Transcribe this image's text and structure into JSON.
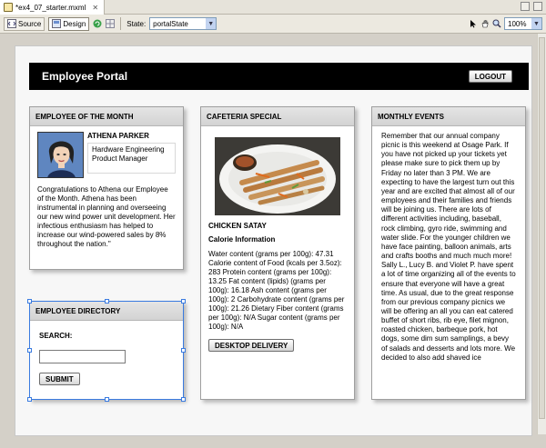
{
  "editor": {
    "tab_label": "*ex4_07_starter.mxml",
    "source_label": "Source",
    "design_label": "Design",
    "state_label": "State:",
    "state_value": "portalState",
    "zoom_value": "100%"
  },
  "header": {
    "title": "Employee Portal",
    "logout_label": "LOGOUT"
  },
  "employee_of_month": {
    "heading": "EMPLOYEE OF THE MONTH",
    "name": "ATHENA PARKER",
    "department": "Hardware Engineering",
    "role": "Product Manager",
    "blurb": "Congratulations to Athena our Employee of the Month. Athena has been instrumental in planning and overseeing our new wind power unit development. Her infectious enthusiasm has helped to increase our wind-powered sales by 8% throughout the nation.\""
  },
  "cafeteria": {
    "heading": "CAFETERIA SPECIAL",
    "dish": "CHICKEN SATAY",
    "info_heading": "Calorie Information",
    "info_text": "Water content (grams per 100g): 47.31 Calorie content of Food (kcals per 3.5oz): 283 Protein content (grams per 100g): 13.25 Fat content (lipids) (grams per 100g): 16.18 Ash content (grams per 100g): 2 Carbohydrate content (grams per 100g): 21.26 Dietary Fiber content (grams per 100g): N/A Sugar content (grams per 100g): N/A",
    "delivery_label": "DESKTOP DELIVERY"
  },
  "events": {
    "heading": "MONTHLY EVENTS",
    "text": "Remember that our annual company picnic is this weekend at Osage Park. If you have not picked up your tickets yet please make sure to pick them up by Friday no later than 3 PM. We are expecting to have the largest turn out this year and are excited that almost all of our employees and their families and friends will be joining us. There are lots of different activities including, baseball, rock climbing, gyro ride, swimming and water slide. For the younger children we have face painting, balloon animals, arts and crafts booths and much much more! Sally L., Lucy B. and Violet P. have spent a lot of time organizing all of the events to ensure that everyone will have a great time. As usual, due to the great response from our previous company picnics we will be offering an all you can eat catered buffet of short ribs, rib eye, filet mignon, roasted chicken, barbeque pork, hot dogs, some dim sum samplings, a bevy of salads and desserts and lots more. We decided to also add shaved ice"
  },
  "directory": {
    "heading": "EMPLOYEE DIRECTORY",
    "search_label": "SEARCH:",
    "search_value": "",
    "submit_label": "SUBMIT"
  }
}
